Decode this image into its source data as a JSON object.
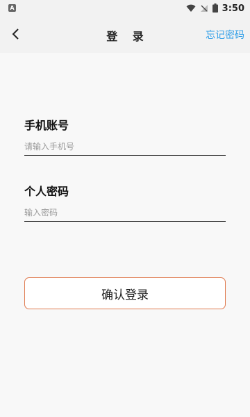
{
  "status_bar": {
    "left_badge": "A",
    "time": "3:50",
    "icons": [
      "wifi-icon",
      "no-signal-icon",
      "battery-icon"
    ]
  },
  "header": {
    "title": "登 录",
    "forgot_link": "忘记密码",
    "back_icon": "chevron-left-icon"
  },
  "form": {
    "phone": {
      "label": "手机账号",
      "placeholder": "请输入手机号",
      "value": ""
    },
    "password": {
      "label": "个人密码",
      "placeholder": "输入密码",
      "value": ""
    },
    "submit_label": "确认登录"
  },
  "colors": {
    "accent_link": "#2f9ee8",
    "button_border": "#e07a4f",
    "background": "#f8f8f8"
  }
}
